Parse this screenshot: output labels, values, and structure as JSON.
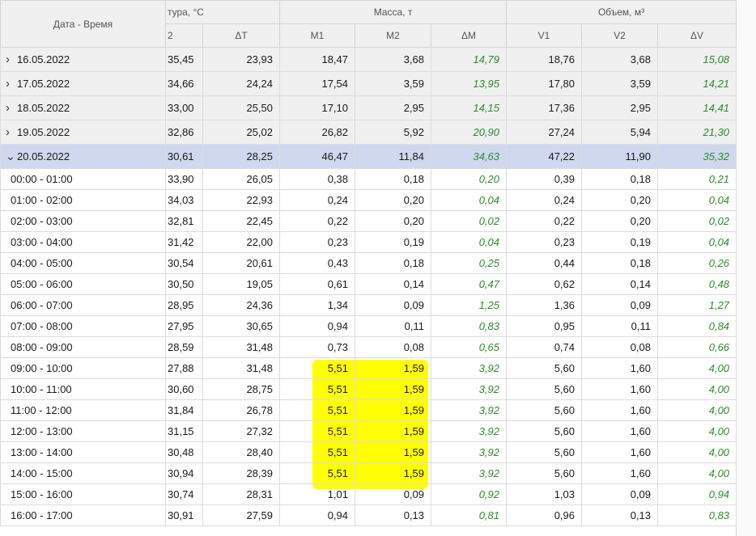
{
  "header": {
    "datetime": "Дата - Время",
    "temperature_group": "тура, °C",
    "mass_group": "Масса, т",
    "volume_group": "Объем, м³",
    "cols": [
      "2",
      "ΔT",
      "M1",
      "M2",
      "ΔM",
      "V1",
      "V2",
      "ΔV"
    ]
  },
  "groups": [
    {
      "label": "16.05.2022",
      "expanded": false,
      "values": [
        "35,45",
        "23,93",
        "18,47",
        "3,68",
        "14,79",
        "18,76",
        "3,68",
        "15,08"
      ]
    },
    {
      "label": "17.05.2022",
      "expanded": false,
      "values": [
        "34,66",
        "24,24",
        "17,54",
        "3,59",
        "13,95",
        "17,80",
        "3,59",
        "14,21"
      ]
    },
    {
      "label": "18.05.2022",
      "expanded": false,
      "values": [
        "33,00",
        "25,50",
        "17,10",
        "2,95",
        "14,15",
        "17,36",
        "2,95",
        "14,41"
      ]
    },
    {
      "label": "19.05.2022",
      "expanded": false,
      "values": [
        "32,86",
        "25,02",
        "26,82",
        "5,92",
        "20,90",
        "27,24",
        "5,94",
        "21,30"
      ]
    },
    {
      "label": "20.05.2022",
      "expanded": true,
      "selected": true,
      "values": [
        "30,61",
        "28,25",
        "46,47",
        "11,84",
        "34,63",
        "47,22",
        "11,90",
        "35,32"
      ]
    }
  ],
  "hours": [
    {
      "label": "00:00 - 01:00",
      "values": [
        "33,90",
        "26,05",
        "0,38",
        "0,18",
        "0,20",
        "0,39",
        "0,18",
        "0,21"
      ]
    },
    {
      "label": "01:00 - 02:00",
      "values": [
        "34,03",
        "22,93",
        "0,24",
        "0,20",
        "0,04",
        "0,24",
        "0,20",
        "0,04"
      ]
    },
    {
      "label": "02:00 - 03:00",
      "values": [
        "32,81",
        "22,45",
        "0,22",
        "0,20",
        "0,02",
        "0,22",
        "0,20",
        "0,02"
      ]
    },
    {
      "label": "03:00 - 04:00",
      "values": [
        "31,42",
        "22,00",
        "0,23",
        "0,19",
        "0,04",
        "0,23",
        "0,19",
        "0,04"
      ]
    },
    {
      "label": "04:00 - 05:00",
      "values": [
        "30,54",
        "20,61",
        "0,43",
        "0,18",
        "0,25",
        "0,44",
        "0,18",
        "0,26"
      ]
    },
    {
      "label": "05:00 - 06:00",
      "values": [
        "30,50",
        "19,05",
        "0,61",
        "0,14",
        "0,47",
        "0,62",
        "0,14",
        "0,48"
      ]
    },
    {
      "label": "06:00 - 07:00",
      "values": [
        "28,95",
        "24,36",
        "1,34",
        "0,09",
        "1,25",
        "1,36",
        "0,09",
        "1,27"
      ]
    },
    {
      "label": "07:00 - 08:00",
      "values": [
        "27,95",
        "30,65",
        "0,94",
        "0,11",
        "0,83",
        "0,95",
        "0,11",
        "0,84"
      ]
    },
    {
      "label": "08:00 - 09:00",
      "values": [
        "28,59",
        "31,48",
        "0,73",
        "0,08",
        "0,65",
        "0,74",
        "0,08",
        "0,66"
      ]
    },
    {
      "label": "09:00 - 10:00",
      "values": [
        "27,88",
        "31,48",
        "5,51",
        "1,59",
        "3,92",
        "5,60",
        "1,60",
        "4,00"
      ],
      "highlight": true
    },
    {
      "label": "10:00 - 11:00",
      "values": [
        "30,60",
        "28,75",
        "5,51",
        "1,59",
        "3,92",
        "5,60",
        "1,60",
        "4,00"
      ],
      "highlight": true
    },
    {
      "label": "11:00 - 12:00",
      "values": [
        "31,84",
        "26,78",
        "5,51",
        "1,59",
        "3,92",
        "5,60",
        "1,60",
        "4,00"
      ],
      "highlight": true
    },
    {
      "label": "12:00 - 13:00",
      "values": [
        "31,15",
        "27,32",
        "5,51",
        "1,59",
        "3,92",
        "5,60",
        "1,60",
        "4,00"
      ],
      "highlight": true
    },
    {
      "label": "13:00 - 14:00",
      "values": [
        "30,48",
        "28,40",
        "5,51",
        "1,59",
        "3,92",
        "5,60",
        "1,60",
        "4,00"
      ],
      "highlight": true
    },
    {
      "label": "14:00 - 15:00",
      "values": [
        "30,94",
        "28,39",
        "5,51",
        "1,59",
        "3,92",
        "5,60",
        "1,60",
        "4,00"
      ],
      "highlight": true
    },
    {
      "label": "15:00 - 16:00",
      "values": [
        "30,74",
        "28,31",
        "1,01",
        "0,09",
        "0,92",
        "1,03",
        "0,09",
        "0,94"
      ]
    },
    {
      "label": "16:00 - 17:00",
      "values": [
        "30,91",
        "27,59",
        "0,94",
        "0,13",
        "0,81",
        "0,96",
        "0,13",
        "0,83"
      ]
    }
  ],
  "colors": {
    "delta_text": "#2e8b2e",
    "highlight": "#ffff00",
    "selected_row": "#cfd8ee"
  },
  "icons": {
    "collapsed": "chevron-right-icon",
    "expanded": "chevron-down-icon"
  }
}
